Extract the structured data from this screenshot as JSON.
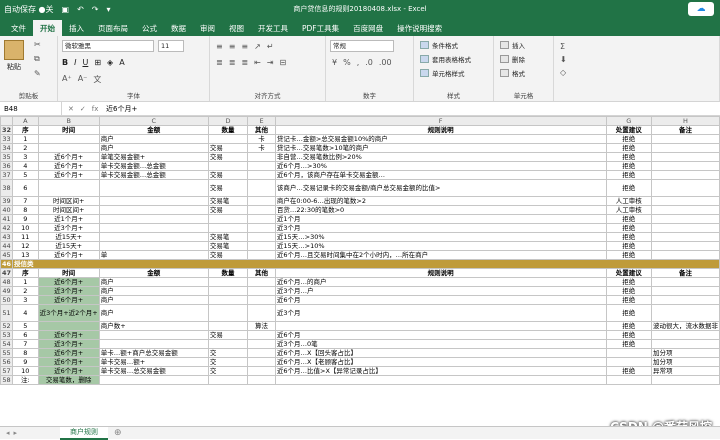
{
  "titlebar": {
    "autosave": "自动保存 ●关",
    "title": "商户贷信息的规则20180408.xlsx  -  Excel"
  },
  "tabs": [
    "文件",
    "开始",
    "插入",
    "页面布局",
    "公式",
    "数据",
    "审阅",
    "视图",
    "开发工具",
    "PDF工具集",
    "百度网盘",
    "操作说明搜索"
  ],
  "active_tab": "开始",
  "ribbon": {
    "clipboard": {
      "paste": "粘贴",
      "label": "剪贴板"
    },
    "font": {
      "name": "微软雅黑",
      "size": "11",
      "label": "字体"
    },
    "align": {
      "label": "对齐方式"
    },
    "number": {
      "format": "常规",
      "label": "数字"
    },
    "styles": {
      "cond": "条件格式",
      "table": "套用表格格式",
      "cell": "单元格样式",
      "label": "样式"
    },
    "cells": {
      "insert": "插入",
      "delete": "删除",
      "format": "格式",
      "label": "单元格"
    }
  },
  "formula_bar": {
    "cell_ref": "B48",
    "value": "近6个月+"
  },
  "columns": [
    "",
    "A",
    "B",
    "C",
    "D",
    "E",
    "F",
    "G",
    "H"
  ],
  "top_header": {
    "row": "32",
    "cells": [
      "序",
      "时间",
      "金额",
      "数量",
      "其他",
      "规则说明",
      "处置建议",
      "备注"
    ]
  },
  "top_rows": [
    {
      "row": "33",
      "a": "1",
      "b": "",
      "c": "商户",
      "d": "",
      "e": "卡",
      "f": "贷记卡…金额>总交易金额10%的商户",
      "g": "拒绝",
      "h": ""
    },
    {
      "row": "34",
      "a": "2",
      "b": "",
      "c": "商户",
      "d": "交易",
      "e": "卡",
      "f": "贷记卡…交易笔数>10笔的商户",
      "g": "拒绝",
      "h": ""
    },
    {
      "row": "35",
      "a": "3",
      "b": "近6个月+",
      "c": "单笔交易金额+",
      "d": "交易",
      "e": "",
      "f": "非自营…交易笔数比例>20%",
      "g": "拒绝",
      "h": ""
    },
    {
      "row": "36",
      "a": "4",
      "b": "近6个月+",
      "c": "单卡交易金额…总金额",
      "d": "",
      "e": "",
      "f": "近6个月…>30%",
      "g": "拒绝",
      "h": ""
    },
    {
      "row": "37",
      "a": "5",
      "b": "近6个月+",
      "c": "单卡交易金额…总金额",
      "d": "交易",
      "e": "",
      "f": "近6个月，该商户存在单卡交易金额…",
      "g": "拒绝",
      "h": ""
    },
    {
      "row": "38",
      "a": "6",
      "b": "",
      "c": "",
      "d": "交易",
      "e": "",
      "f": "该商户…交易记录卡的交易金额/商户总交易金额的比值>",
      "g": "拒绝",
      "h": "",
      "tall": true
    },
    {
      "row": "39",
      "a": "7",
      "b": "时间区间+",
      "c": "",
      "d": "交易笔",
      "e": "",
      "f": "商户在0:00-6…出现的笔数>2",
      "g": "人工审核",
      "h": ""
    },
    {
      "row": "40",
      "a": "8",
      "b": "时间区间+",
      "c": "",
      "d": "交易",
      "e": "",
      "f": "百货…22:30的笔数>0",
      "g": "人工审核",
      "h": ""
    },
    {
      "row": "41",
      "a": "9",
      "b": "近1个月+",
      "c": "",
      "d": "",
      "e": "",
      "f": "近1个月",
      "g": "拒绝",
      "h": ""
    },
    {
      "row": "42",
      "a": "10",
      "b": "近3个月+",
      "c": "",
      "d": "",
      "e": "",
      "f": "近3个月",
      "g": "拒绝",
      "h": ""
    },
    {
      "row": "43",
      "a": "11",
      "b": "近15天+",
      "c": "",
      "d": "交易笔",
      "e": "",
      "f": "近15天…>30%",
      "g": "拒绝",
      "h": ""
    },
    {
      "row": "44",
      "a": "12",
      "b": "近15天+",
      "c": "",
      "d": "交易笔",
      "e": "",
      "f": "近15天…>10%",
      "g": "拒绝",
      "h": ""
    },
    {
      "row": "45",
      "a": "13",
      "b": "近6个月+",
      "c": "单",
      "d": "交易",
      "e": "",
      "f": "近6个月…且交易时间集中在2个小时内，…所在商户",
      "g": "拒绝",
      "h": ""
    }
  ],
  "section_label": "授信类",
  "bottom_header": {
    "row": "47",
    "cells": [
      "序",
      "时间",
      "金额",
      "数量",
      "其他",
      "规则说明",
      "处置建议",
      "备注"
    ]
  },
  "bottom_rows": [
    {
      "row": "48",
      "a": "1",
      "b": "近6个月+",
      "c": "商户",
      "d": "",
      "e": "",
      "f": "近6个月…的商户",
      "g": "拒绝",
      "h": ""
    },
    {
      "row": "49",
      "a": "2",
      "b": "近3个月+",
      "c": "商户",
      "d": "",
      "e": "",
      "f": "近3个月…户",
      "g": "拒绝",
      "h": ""
    },
    {
      "row": "50",
      "a": "3",
      "b": "近6个月+",
      "c": "商户",
      "d": "",
      "e": "",
      "f": "近6个月",
      "g": "拒绝",
      "h": ""
    },
    {
      "row": "51",
      "a": "4",
      "b": "近3个月+近2个月+",
      "c": "商户",
      "d": "",
      "e": "",
      "f": "近3个月",
      "g": "拒绝",
      "h": "",
      "tall": true
    },
    {
      "row": "52",
      "a": "5",
      "b": "",
      "c": "商户数+",
      "d": "",
      "e": "算法",
      "f": "",
      "g": "拒绝",
      "h": "波动很大，流水数据非"
    },
    {
      "row": "53",
      "a": "6",
      "b": "近6个月+",
      "c": "",
      "d": "交易",
      "e": "",
      "f": "近6个月",
      "g": "拒绝",
      "h": ""
    },
    {
      "row": "54",
      "a": "7",
      "b": "近3个月+",
      "c": "",
      "d": "",
      "e": "",
      "f": "近3个月…0笔",
      "g": "拒绝",
      "h": ""
    },
    {
      "row": "55",
      "a": "8",
      "b": "近6个月+",
      "c": "单卡…额+商户总交易金额",
      "d": "交",
      "e": "",
      "f": "近6个月…X【回头客占比】",
      "g": "",
      "h": "加分项"
    },
    {
      "row": "56",
      "a": "9",
      "b": "近6个月+",
      "c": "单卡交易…额+",
      "d": "交",
      "e": "",
      "f": "近6个月…X【老顾客占比】",
      "g": "",
      "h": "加分项"
    },
    {
      "row": "57",
      "a": "10",
      "b": "近6个月+",
      "c": "单卡交易…总交易金额",
      "d": "交",
      "e": "",
      "f": "近6个月…比值>X【异常记录占比】",
      "g": "拒绝",
      "h": "异常项"
    },
    {
      "row": "58",
      "a": "注:",
      "b": "交易笔数，删除",
      "c": "",
      "d": "",
      "e": "",
      "f": "",
      "g": "",
      "h": ""
    }
  ],
  "sheet_tab": "商户规则",
  "watermark": "CSDN @番茄风控",
  "colors": {
    "excel_green": "#217346",
    "section_fill": "#bf9b3a",
    "selected_fill": "#a6c8a6"
  }
}
